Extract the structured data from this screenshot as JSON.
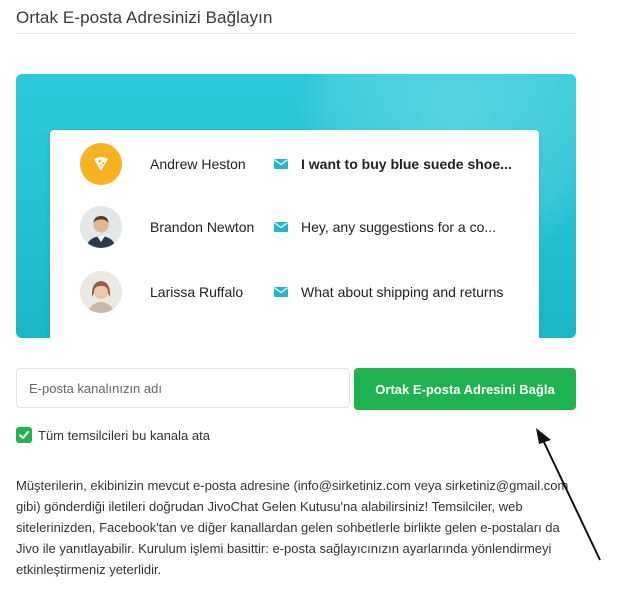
{
  "page": {
    "title": "Ortak E-posta Adresinizi Bağlayın"
  },
  "preview": {
    "rows": [
      {
        "name": "Andrew Heston",
        "avatar": "pizza-avatar-icon",
        "message": "I want to buy blue suede shoe..."
      },
      {
        "name": "Brandon Newton",
        "avatar": "photo-avatar",
        "message": "Hey, any suggestions for a co..."
      },
      {
        "name": "Larissa Ruffalo",
        "avatar": "photo-avatar",
        "message": "What about shipping and returns"
      }
    ],
    "icon": "mail-icon",
    "accent": "#22c3d3"
  },
  "form": {
    "input_placeholder": "E-posta kanalınızın adı",
    "input_value": "",
    "button_label": "Ortak E-posta Adresini Bağla",
    "button_color": "#1fb250",
    "checkbox_label": "Tüm temsilcileri bu kanala ata",
    "checkbox_checked": true
  },
  "description": "Müşterilerin, ekibinizin mevcut e-posta adresine (info@sirketiniz.com veya sirketiniz@gmail.com gibi) gönderdiği iletileri doğrudan JivoChat Gelen Kutusu'na alabilirsiniz! Temsilciler, web sitelerinizden, Facebook'tan ve diğer kanallardan gelen sohbetlerle birlikte gelen e-postaları da Jivo ile yanıtlayabilir. Kurulum işlemi basittir: e-posta sağlayıcınızın ayarlarında yönlendirmeyi etkinleştirmeniz yeterlidir."
}
